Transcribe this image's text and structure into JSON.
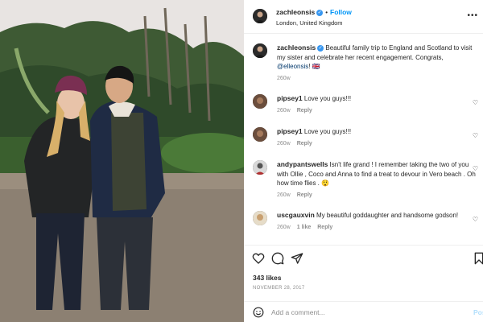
{
  "post": {
    "username": "zachleonsis",
    "location": "London, United Kingdom",
    "follow_label": "Follow",
    "dot": "•",
    "caption": {
      "text": "Beautiful family trip to England and Scotland to visit my sister and celebrate her recent engagement. Congrats,",
      "mention": "@elleonsis",
      "suffix": "! 🇬🇧",
      "time": "260w"
    },
    "likes": "343 likes",
    "date": "NOVEMBER 28, 2017"
  },
  "comments": [
    {
      "username": "pipsey1",
      "text": "Love you guys!!!",
      "time": "260w",
      "reply": "Reply"
    },
    {
      "username": "pipsey1",
      "text": "Love you guys!!!",
      "time": "260w",
      "reply": "Reply"
    },
    {
      "username": "andypantswells",
      "text": "Isn't life grand ! I remember taking the two of you with Ollie , Coco and Anna to find a treat to devour in Vero beach . Oh how time flies .",
      "emoji": "😲",
      "time": "260w",
      "reply": "Reply"
    },
    {
      "username": "uscgauxvin",
      "text": "My beautiful goddaughter and handsome godson!",
      "time": "260w",
      "likes": "1 like",
      "reply": "Reply"
    }
  ],
  "add_comment": {
    "placeholder": "Add a comment...",
    "post_label": "Post"
  },
  "icons": {
    "verified": "verified-badge-icon",
    "heart": "heart-icon",
    "comment": "comment-icon",
    "share": "share-icon",
    "bookmark": "bookmark-icon",
    "emoji": "emoji-icon",
    "more": "more-options-icon"
  },
  "colors": {
    "accent": "#0095f6",
    "verified": "#3897f0",
    "muted": "#8e8e8e",
    "text": "#262626"
  }
}
